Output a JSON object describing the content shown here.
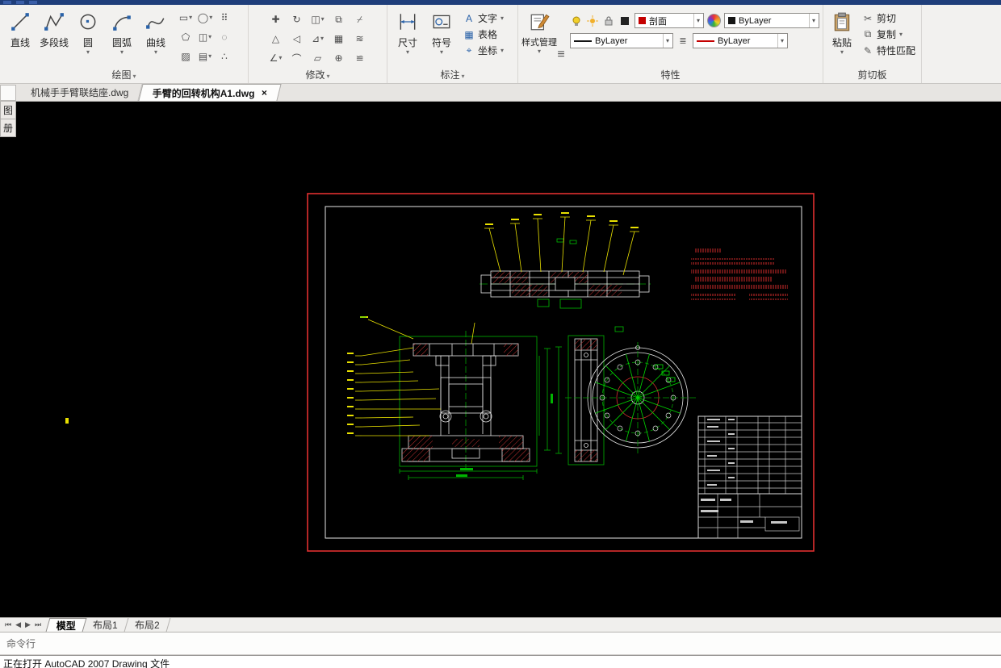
{
  "ribbon": {
    "draw": {
      "label": "绘图",
      "buttons": [
        {
          "label": "直线"
        },
        {
          "label": "多段线"
        },
        {
          "label": "圆"
        },
        {
          "label": "圆弧"
        },
        {
          "label": "曲线"
        }
      ],
      "grid_icons": [
        "▭",
        "◯",
        "⠿",
        "⬠",
        "◫",
        "◌",
        "▨",
        "▤",
        "∴"
      ]
    },
    "modify": {
      "label": "修改",
      "grid_icons": [
        "✚",
        "↻",
        "◫",
        "⧉",
        "⌿",
        "△",
        "◁",
        "⊿",
        "▦",
        "≋",
        "∠",
        "⌒",
        "▱",
        "⊕",
        "≌"
      ]
    },
    "annotate": {
      "label": "标注",
      "dim_label": "尺寸",
      "symbol_label": "符号",
      "smalls": [
        {
          "icon": "A",
          "label": "文字"
        },
        {
          "icon": "▦",
          "label": "表格"
        },
        {
          "icon": "⌖",
          "label": "坐标"
        }
      ]
    },
    "properties": {
      "label": "特性",
      "style_label": "样式管理",
      "layer_value": "剖面",
      "color_value": "ByLayer",
      "linetype_value": "ByLayer",
      "lineweight_value": "ByLayer"
    },
    "clipboard": {
      "label": "剪切板",
      "paste_label": "粘贴",
      "cut_label": "剪切",
      "copy_label": "复制",
      "match_label": "特性匹配"
    }
  },
  "icons": {
    "caret": "▾",
    "list": "≡",
    "list2": "≣",
    "cut": "✂",
    "copy": "⧉",
    "match": "✎"
  },
  "file_tabs": {
    "tab1": "机械手手臂联结座.dwg",
    "tab2": "手臂的回转机构A1.dwg",
    "close": "×"
  },
  "palette": {
    "char1": "图",
    "char2": "册"
  },
  "layout_tabs": {
    "nav": [
      "⏮",
      "◀",
      "▶",
      "⏭"
    ],
    "model": "模型",
    "layout1": "布局1",
    "layout2": "布局2"
  },
  "command": {
    "panel_label": "命令行",
    "status": "正在打开 AutoCAD 2007 Drawing 文件"
  },
  "colors": {
    "frame_red": "#e03030",
    "cad_green": "#00b400",
    "cad_yellow": "#e8e000",
    "cad_white": "#e6e6e6",
    "titlebar_blue": "#1f3e7a"
  }
}
